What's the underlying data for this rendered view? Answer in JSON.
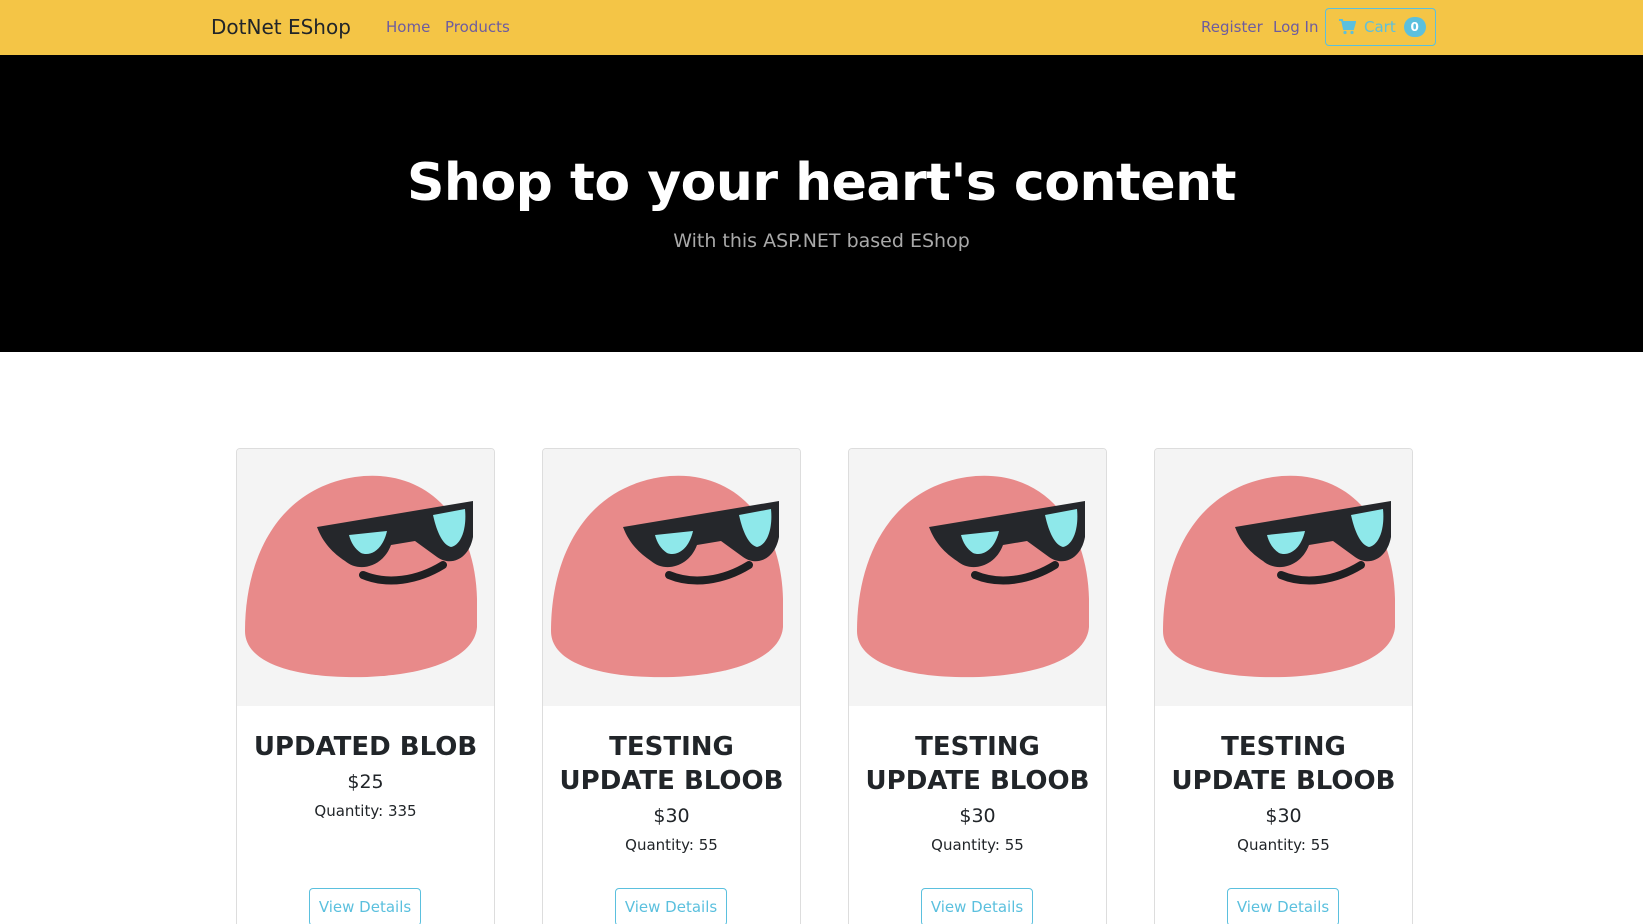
{
  "navbar": {
    "brand": "DotNet EShop",
    "links": {
      "home": "Home",
      "products": "Products",
      "register": "Register",
      "login": "Log In"
    },
    "cart": {
      "label": "Cart",
      "count": "0"
    }
  },
  "hero": {
    "title": "Shop to your heart's content",
    "subtitle": "With this ASP.NET based EShop"
  },
  "products": [
    {
      "name": "UPDATED BLOB",
      "price": "$25",
      "quantity": "Quantity: 335",
      "button": "View Details"
    },
    {
      "name": "TESTING UPDATE BLOOB",
      "price": "$30",
      "quantity": "Quantity: 55",
      "button": "View Details"
    },
    {
      "name": "TESTING UPDATE BLOOB",
      "price": "$30",
      "quantity": "Quantity: 55",
      "button": "View Details"
    },
    {
      "name": "TESTING UPDATE BLOOB",
      "price": "$30",
      "quantity": "Quantity: 55",
      "button": "View Details"
    }
  ],
  "colors": {
    "navbar_bg": "#f4c546",
    "nav_link": "#6d5c9f",
    "accent": "#5bc0de",
    "hero_bg": "#000000",
    "blob_pink": "#e88a8a"
  },
  "icons": {
    "cart": "shopping-cart-icon",
    "product_image": "cool-blob-sunglasses-image"
  }
}
